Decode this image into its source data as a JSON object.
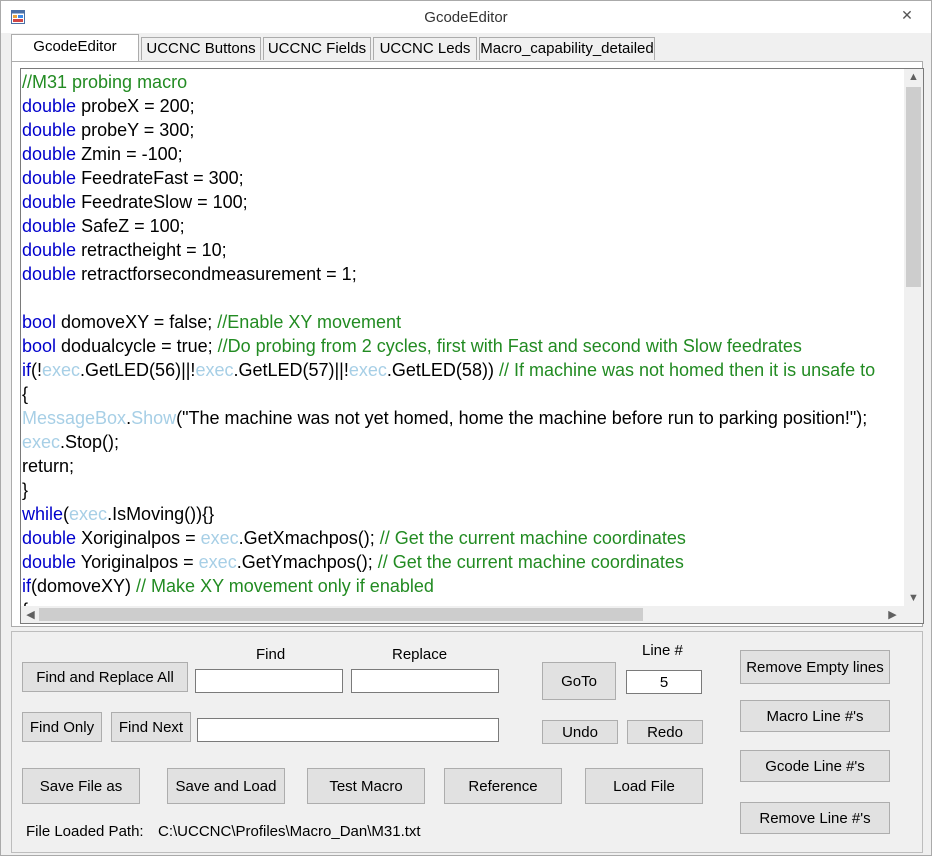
{
  "window": {
    "title": "GcodeEditor",
    "close_glyph": "✕",
    "icon": "app-window-icon"
  },
  "tabs": [
    {
      "label": "GcodeEditor",
      "active": true
    },
    {
      "label": "UCCNC Buttons",
      "active": false
    },
    {
      "label": "UCCNC Fields",
      "active": false
    },
    {
      "label": "UCCNC Leds",
      "active": false
    },
    {
      "label": "Macro_capability_detailed",
      "active": false
    }
  ],
  "editor": {
    "lines": [
      {
        "tokens": [
          [
            "cm",
            "//M31 probing macro"
          ]
        ]
      },
      {
        "tokens": [
          [
            "kw",
            "double"
          ],
          [
            "tx",
            " probeX = 200;"
          ]
        ]
      },
      {
        "tokens": [
          [
            "kw",
            "double"
          ],
          [
            "tx",
            " probeY = 300;"
          ]
        ]
      },
      {
        "tokens": [
          [
            "kw",
            "double"
          ],
          [
            "tx",
            " Zmin = -100;"
          ]
        ]
      },
      {
        "tokens": [
          [
            "kw",
            "double"
          ],
          [
            "tx",
            " FeedrateFast = 300;"
          ]
        ]
      },
      {
        "tokens": [
          [
            "kw",
            "double"
          ],
          [
            "tx",
            " FeedrateSlow = 100;"
          ]
        ]
      },
      {
        "tokens": [
          [
            "kw",
            "double"
          ],
          [
            "tx",
            " SafeZ = 100;"
          ]
        ]
      },
      {
        "tokens": [
          [
            "kw",
            "double"
          ],
          [
            "tx",
            " retractheight = 10;"
          ]
        ]
      },
      {
        "tokens": [
          [
            "kw",
            "double"
          ],
          [
            "tx",
            " retractforsecondmeasurement = 1;"
          ]
        ]
      },
      {
        "tokens": [
          [
            "tx",
            ""
          ]
        ]
      },
      {
        "tokens": [
          [
            "kw",
            "bool"
          ],
          [
            "tx",
            " domoveXY = false; "
          ],
          [
            "cm",
            "//Enable XY movement"
          ]
        ]
      },
      {
        "tokens": [
          [
            "kw",
            "bool"
          ],
          [
            "tx",
            " dodualcycle = true; "
          ],
          [
            "cm",
            "//Do probing from 2 cycles, first with Fast and second with Slow feedrates"
          ]
        ]
      },
      {
        "tokens": [
          [
            "kw",
            "if"
          ],
          [
            "tx",
            "(!"
          ],
          [
            "obj",
            "exec"
          ],
          [
            "tx",
            ".GetLED(56)||!"
          ],
          [
            "obj",
            "exec"
          ],
          [
            "tx",
            ".GetLED(57)||!"
          ],
          [
            "obj",
            "exec"
          ],
          [
            "tx",
            ".GetLED(58)) "
          ],
          [
            "cm",
            "// If machine was not homed then it is unsafe to"
          ]
        ]
      },
      {
        "tokens": [
          [
            "tx",
            "{"
          ]
        ]
      },
      {
        "tokens": [
          [
            "obj",
            "MessageBox"
          ],
          [
            "tx",
            "."
          ],
          [
            "obj",
            "Show"
          ],
          [
            "tx",
            "(\"The machine was not yet homed, home the machine before run to parking position!\");"
          ]
        ]
      },
      {
        "tokens": [
          [
            "obj",
            "exec"
          ],
          [
            "tx",
            ".Stop();"
          ]
        ]
      },
      {
        "tokens": [
          [
            "tx",
            "return;"
          ]
        ]
      },
      {
        "tokens": [
          [
            "tx",
            "}"
          ]
        ]
      },
      {
        "tokens": [
          [
            "kw",
            "while"
          ],
          [
            "tx",
            "("
          ],
          [
            "obj",
            "exec"
          ],
          [
            "tx",
            ".IsMoving()){}"
          ]
        ]
      },
      {
        "tokens": [
          [
            "kw",
            "double"
          ],
          [
            "tx",
            " Xoriginalpos = "
          ],
          [
            "obj",
            "exec"
          ],
          [
            "tx",
            ".GetXmachpos(); "
          ],
          [
            "cm",
            "// Get the current machine coordinates"
          ]
        ]
      },
      {
        "tokens": [
          [
            "kw",
            "double"
          ],
          [
            "tx",
            " Yoriginalpos = "
          ],
          [
            "obj",
            "exec"
          ],
          [
            "tx",
            ".GetYmachpos(); "
          ],
          [
            "cm",
            "// Get the current machine coordinates"
          ]
        ]
      },
      {
        "tokens": [
          [
            "kw",
            "if"
          ],
          [
            "tx",
            "(domoveXY) "
          ],
          [
            "cm",
            "// Make XY movement only if enabled"
          ]
        ]
      },
      {
        "tokens": [
          [
            "tx",
            "{"
          ]
        ]
      }
    ]
  },
  "controls": {
    "find_label": "Find",
    "replace_label": "Replace",
    "line_label": "Line #",
    "find_value": "",
    "replace_value": "",
    "find_only_value": "",
    "line_value": "5",
    "find_replace_all": "Find and Replace All",
    "find_only": "Find Only",
    "find_next": "Find Next",
    "goto": "GoTo",
    "undo": "Undo",
    "redo": "Redo",
    "remove_empty_lines": "Remove Empty lines",
    "macro_line_numbers": "Macro Line #'s",
    "gcode_line_numbers": "Gcode Line #'s",
    "remove_line_numbers": "Remove Line #'s",
    "save_file_as": "Save File as",
    "save_and_load": "Save and Load",
    "test_macro": "Test Macro",
    "reference": "Reference",
    "load_file": "Load File",
    "file_loaded_label": "File Loaded Path:",
    "file_loaded_path": "C:\\UCCNC\\Profiles\\Macro_Dan\\M31.txt"
  },
  "colors": {
    "keyword": "#0000cc",
    "comment": "#228b22",
    "object": "#a7cfe6"
  }
}
